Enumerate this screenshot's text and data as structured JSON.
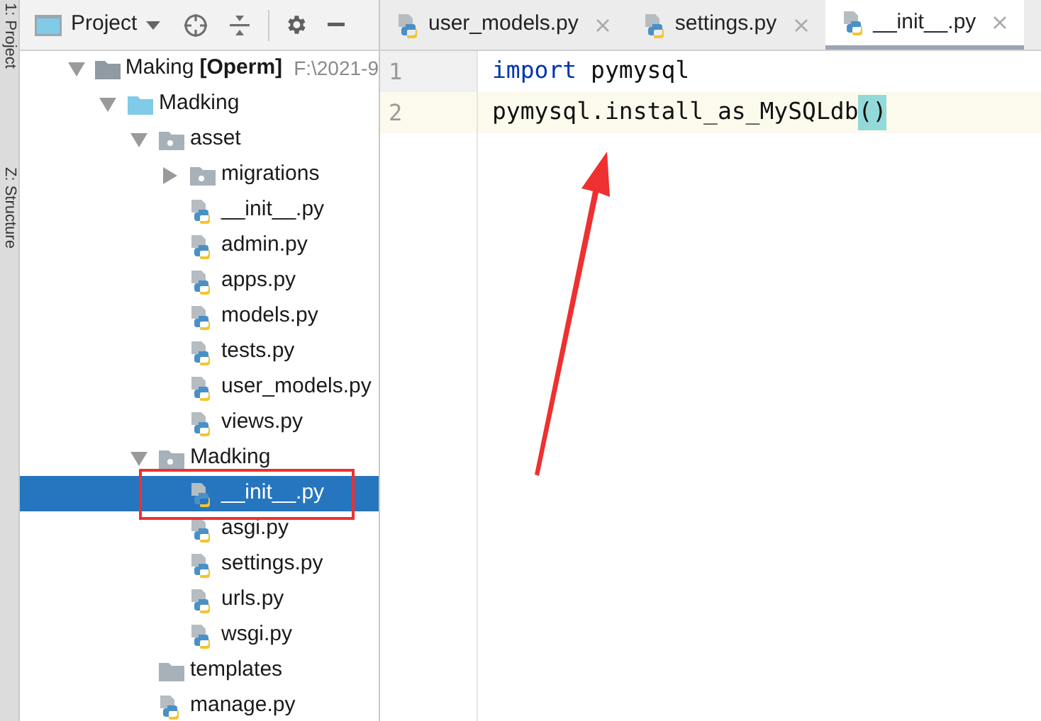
{
  "side_strip": [
    "1: Project",
    "Z: Structure"
  ],
  "project_panel": {
    "title": "Project",
    "tree": [
      {
        "kind": "root",
        "name": "Making",
        "module": "[Operm]",
        "path": "F:\\2021-9",
        "expanded": true,
        "selected": false,
        "children": [
          {
            "kind": "source",
            "name": "Madking",
            "expanded": true,
            "selected": false,
            "children": [
              {
                "kind": "package",
                "name": "asset",
                "expanded": true,
                "selected": false,
                "children": [
                  {
                    "kind": "package",
                    "name": "migrations",
                    "expanded": false,
                    "selected": false
                  },
                  {
                    "kind": "file",
                    "name": "__init__.py",
                    "selected": false
                  },
                  {
                    "kind": "file",
                    "name": "admin.py",
                    "selected": false
                  },
                  {
                    "kind": "file",
                    "name": "apps.py",
                    "selected": false
                  },
                  {
                    "kind": "file",
                    "name": "models.py",
                    "selected": false
                  },
                  {
                    "kind": "file",
                    "name": "tests.py",
                    "selected": false
                  },
                  {
                    "kind": "file",
                    "name": "user_models.py",
                    "selected": false
                  },
                  {
                    "kind": "file",
                    "name": "views.py",
                    "selected": false
                  }
                ]
              },
              {
                "kind": "package",
                "name": "Madking",
                "expanded": true,
                "selected": false,
                "children": [
                  {
                    "kind": "file",
                    "name": "__init__.py",
                    "selected": true,
                    "highlighted": true
                  },
                  {
                    "kind": "file",
                    "name": "asgi.py",
                    "selected": false
                  },
                  {
                    "kind": "file",
                    "name": "settings.py",
                    "selected": false
                  },
                  {
                    "kind": "file",
                    "name": "urls.py",
                    "selected": false
                  },
                  {
                    "kind": "file",
                    "name": "wsgi.py",
                    "selected": false
                  }
                ]
              },
              {
                "kind": "folder",
                "name": "templates",
                "selected": false
              },
              {
                "kind": "file",
                "name": "manage.py",
                "selected": false
              }
            ]
          }
        ]
      }
    ]
  },
  "tabs": [
    {
      "label": "user_models.py",
      "selected": false
    },
    {
      "label": "settings.py",
      "selected": false
    },
    {
      "label": "__init__.py",
      "selected": true
    }
  ],
  "editor": {
    "lines": [
      {
        "number": "1",
        "current": false,
        "tokens": [
          {
            "kind": "keyword",
            "text": "import"
          },
          {
            "kind": "plain",
            "text": " pymysql"
          }
        ]
      },
      {
        "number": "2",
        "current": true,
        "tokens": [
          {
            "kind": "plain",
            "text": "pymysql.install_as_MySQLdb"
          },
          {
            "kind": "brace_match",
            "text": "()"
          }
        ]
      }
    ]
  }
}
